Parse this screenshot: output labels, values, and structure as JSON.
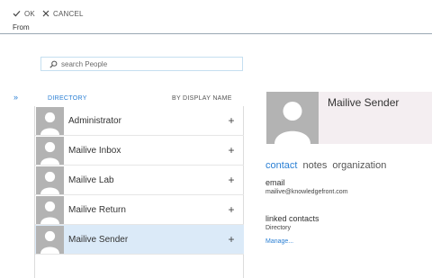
{
  "toolbar": {
    "ok_label": "OK",
    "cancel_label": "CANCEL"
  },
  "form": {
    "from_label": "From"
  },
  "search": {
    "placeholder": "search People"
  },
  "directory": {
    "expand_glyph": "»",
    "directory_label": "DIRECTORY",
    "sort_label": "BY DISPLAY NAME",
    "add_glyph": "+",
    "contacts": [
      {
        "name": "Administrator",
        "selected": false
      },
      {
        "name": "Mailive Inbox",
        "selected": false
      },
      {
        "name": "Mailive Lab",
        "selected": false
      },
      {
        "name": "Mailive Return",
        "selected": false
      },
      {
        "name": "Mailive Sender",
        "selected": true
      }
    ]
  },
  "card": {
    "name": "Mailive Sender",
    "tabs": [
      "contact",
      "notes",
      "organization"
    ],
    "active_tab": "contact",
    "email_label": "email",
    "email_value": "mailive@knowledgefront.com",
    "linked_label": "linked contacts",
    "linked_value": "Directory",
    "manage_label": "Manage..."
  },
  "colors": {
    "accent": "#2a7fd4",
    "selected_row": "#dbeaf8",
    "avatar_bg": "#b3b3b3",
    "name_panel_bg": "#f4eef1"
  },
  "icons": {
    "ok": "checkmark-icon",
    "cancel": "close-icon",
    "search": "search-icon",
    "avatar": "person-placeholder-icon",
    "add": "plus-icon",
    "expand": "chevron-double-right-icon"
  }
}
